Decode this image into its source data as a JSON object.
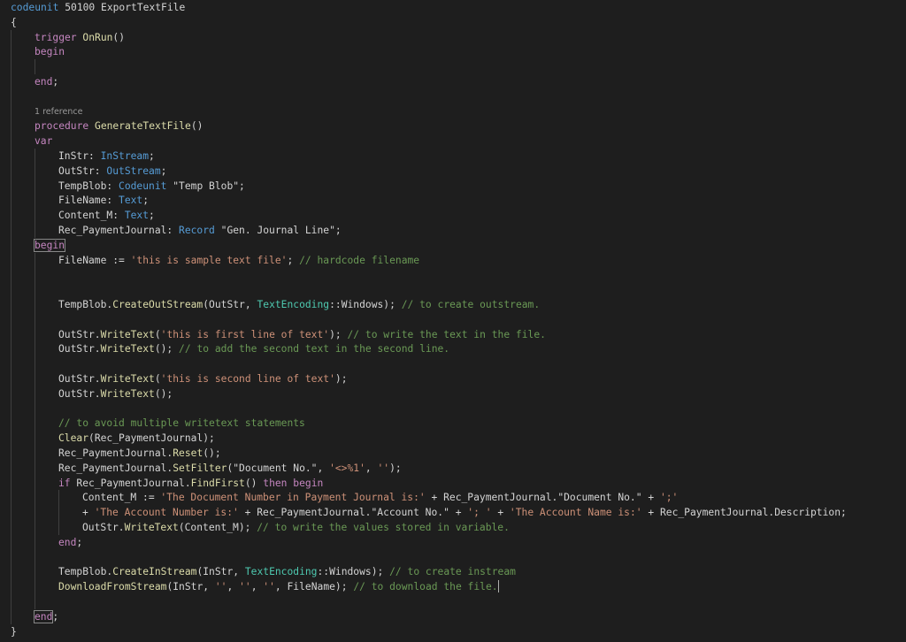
{
  "editor": {
    "theme_colors": {
      "background": "#1e1e1e",
      "keyword": "#569cd6",
      "type": "#4ec9b0",
      "string": "#ce9178",
      "comment": "#6a9955",
      "text": "#d4d4d4",
      "indent_guide": "#404040",
      "bracket_match": "#888888"
    },
    "lines": [
      {
        "indent": 0,
        "tokens": [
          {
            "t": "codeunit",
            "c": "#569cd6"
          },
          {
            "t": " 50100 ExportTextFile",
            "c": "#d4d4d4"
          }
        ]
      },
      {
        "indent": 0,
        "tokens": [
          {
            "t": "{",
            "c": "#d4d4d4"
          }
        ]
      },
      {
        "indent": 1,
        "tokens": [
          {
            "t": "trigger",
            "c": "#c586c0"
          },
          {
            "t": " OnRun",
            "c": "#dcdcaa"
          },
          {
            "t": "()",
            "c": "#d4d4d4"
          }
        ]
      },
      {
        "indent": 1,
        "tokens": [
          {
            "t": "begin",
            "c": "#c586c0"
          }
        ]
      },
      {
        "indent": 0,
        "tokens": []
      },
      {
        "indent": 1,
        "tokens": [
          {
            "t": "end",
            "c": "#c586c0"
          },
          {
            "t": ";",
            "c": "#d4d4d4"
          }
        ]
      },
      {
        "indent": 0,
        "tokens": []
      },
      {
        "indent": 1,
        "lens": true,
        "tokens": [
          {
            "t": "1 reference",
            "c": "#999999"
          }
        ]
      },
      {
        "indent": 1,
        "tokens": [
          {
            "t": "procedure",
            "c": "#c586c0"
          },
          {
            "t": " GenerateTextFile",
            "c": "#dcdcaa"
          },
          {
            "t": "()",
            "c": "#d4d4d4"
          }
        ]
      },
      {
        "indent": 1,
        "tokens": [
          {
            "t": "var",
            "c": "#c586c0"
          }
        ]
      },
      {
        "indent": 2,
        "tokens": [
          {
            "t": "InStr: ",
            "c": "#d4d4d4"
          },
          {
            "t": "InStream",
            "c": "#569cd6"
          },
          {
            "t": ";",
            "c": "#d4d4d4"
          }
        ]
      },
      {
        "indent": 2,
        "tokens": [
          {
            "t": "OutStr: ",
            "c": "#d4d4d4"
          },
          {
            "t": "OutStream",
            "c": "#569cd6"
          },
          {
            "t": ";",
            "c": "#d4d4d4"
          }
        ]
      },
      {
        "indent": 2,
        "tokens": [
          {
            "t": "TempBlob: ",
            "c": "#d4d4d4"
          },
          {
            "t": "Codeunit",
            "c": "#569cd6"
          },
          {
            "t": " \"Temp Blob\";",
            "c": "#d4d4d4"
          }
        ]
      },
      {
        "indent": 2,
        "tokens": [
          {
            "t": "FileName: ",
            "c": "#d4d4d4"
          },
          {
            "t": "Text",
            "c": "#569cd6"
          },
          {
            "t": ";",
            "c": "#d4d4d4"
          }
        ]
      },
      {
        "indent": 2,
        "tokens": [
          {
            "t": "Content_M: ",
            "c": "#d4d4d4"
          },
          {
            "t": "Text",
            "c": "#569cd6"
          },
          {
            "t": ";",
            "c": "#d4d4d4"
          }
        ]
      },
      {
        "indent": 2,
        "tokens": [
          {
            "t": "Rec_PaymentJournal: ",
            "c": "#d4d4d4"
          },
          {
            "t": "Record",
            "c": "#569cd6"
          },
          {
            "t": " \"Gen. Journal Line\";",
            "c": "#d4d4d4"
          }
        ]
      },
      {
        "indent": 1,
        "bracket": true,
        "tokens": [
          {
            "t": "begin",
            "c": "#c586c0"
          }
        ]
      },
      {
        "indent": 2,
        "tokens": [
          {
            "t": "FileName := ",
            "c": "#d4d4d4"
          },
          {
            "t": "'this is sample text file'",
            "c": "#ce9178"
          },
          {
            "t": "; ",
            "c": "#d4d4d4"
          },
          {
            "t": "// hardcode filename",
            "c": "#6a9955"
          }
        ]
      },
      {
        "indent": 0,
        "tokens": []
      },
      {
        "indent": 0,
        "tokens": []
      },
      {
        "indent": 2,
        "tokens": [
          {
            "t": "TempBlob.",
            "c": "#d4d4d4"
          },
          {
            "t": "CreateOutStream",
            "c": "#dcdcaa"
          },
          {
            "t": "(OutStr, ",
            "c": "#d4d4d4"
          },
          {
            "t": "TextEncoding",
            "c": "#4ec9b0"
          },
          {
            "t": "::Windows); ",
            "c": "#d4d4d4"
          },
          {
            "t": "// to create outstream.",
            "c": "#6a9955"
          }
        ]
      },
      {
        "indent": 0,
        "tokens": []
      },
      {
        "indent": 2,
        "tokens": [
          {
            "t": "OutStr.",
            "c": "#d4d4d4"
          },
          {
            "t": "WriteText",
            "c": "#dcdcaa"
          },
          {
            "t": "(",
            "c": "#d4d4d4"
          },
          {
            "t": "'this is first line of text'",
            "c": "#ce9178"
          },
          {
            "t": "); ",
            "c": "#d4d4d4"
          },
          {
            "t": "// to write the text in the file.",
            "c": "#6a9955"
          }
        ]
      },
      {
        "indent": 2,
        "tokens": [
          {
            "t": "OutStr.",
            "c": "#d4d4d4"
          },
          {
            "t": "WriteText",
            "c": "#dcdcaa"
          },
          {
            "t": "(); ",
            "c": "#d4d4d4"
          },
          {
            "t": "// to add the second text in the second line.",
            "c": "#6a9955"
          }
        ]
      },
      {
        "indent": 0,
        "tokens": []
      },
      {
        "indent": 2,
        "tokens": [
          {
            "t": "OutStr.",
            "c": "#d4d4d4"
          },
          {
            "t": "WriteText",
            "c": "#dcdcaa"
          },
          {
            "t": "(",
            "c": "#d4d4d4"
          },
          {
            "t": "'this is second line of text'",
            "c": "#ce9178"
          },
          {
            "t": ");",
            "c": "#d4d4d4"
          }
        ]
      },
      {
        "indent": 2,
        "tokens": [
          {
            "t": "OutStr.",
            "c": "#d4d4d4"
          },
          {
            "t": "WriteText",
            "c": "#dcdcaa"
          },
          {
            "t": "();",
            "c": "#d4d4d4"
          }
        ]
      },
      {
        "indent": 0,
        "tokens": []
      },
      {
        "indent": 2,
        "tokens": [
          {
            "t": "// to avoid multiple writetext statements",
            "c": "#6a9955"
          }
        ]
      },
      {
        "indent": 2,
        "tokens": [
          {
            "t": "Clear",
            "c": "#dcdcaa"
          },
          {
            "t": "(Rec_PaymentJournal);",
            "c": "#d4d4d4"
          }
        ]
      },
      {
        "indent": 2,
        "tokens": [
          {
            "t": "Rec_PaymentJournal.",
            "c": "#d4d4d4"
          },
          {
            "t": "Reset",
            "c": "#dcdcaa"
          },
          {
            "t": "();",
            "c": "#d4d4d4"
          }
        ]
      },
      {
        "indent": 2,
        "tokens": [
          {
            "t": "Rec_PaymentJournal.",
            "c": "#d4d4d4"
          },
          {
            "t": "SetFilter",
            "c": "#dcdcaa"
          },
          {
            "t": "(\"Document No.\", ",
            "c": "#d4d4d4"
          },
          {
            "t": "'<>%1'",
            "c": "#ce9178"
          },
          {
            "t": ", ",
            "c": "#d4d4d4"
          },
          {
            "t": "''",
            "c": "#ce9178"
          },
          {
            "t": ");",
            "c": "#d4d4d4"
          }
        ]
      },
      {
        "indent": 2,
        "tokens": [
          {
            "t": "if",
            "c": "#c586c0"
          },
          {
            "t": " Rec_PaymentJournal.",
            "c": "#d4d4d4"
          },
          {
            "t": "FindFirst",
            "c": "#dcdcaa"
          },
          {
            "t": "() ",
            "c": "#d4d4d4"
          },
          {
            "t": "then",
            "c": "#c586c0"
          },
          {
            "t": " ",
            "c": "#d4d4d4"
          },
          {
            "t": "begin",
            "c": "#c586c0"
          }
        ]
      },
      {
        "indent": 3,
        "tokens": [
          {
            "t": "Content_M := ",
            "c": "#d4d4d4"
          },
          {
            "t": "'The Document Number in Payment Journal is:'",
            "c": "#ce9178"
          },
          {
            "t": " + Rec_PaymentJournal.\"Document No.\" + ",
            "c": "#d4d4d4"
          },
          {
            "t": "';'",
            "c": "#ce9178"
          }
        ]
      },
      {
        "indent": 3,
        "tokens": [
          {
            "t": "+ ",
            "c": "#d4d4d4"
          },
          {
            "t": "'The Account Number is:'",
            "c": "#ce9178"
          },
          {
            "t": " + Rec_PaymentJournal.\"Account No.\" + ",
            "c": "#d4d4d4"
          },
          {
            "t": "'; '",
            "c": "#ce9178"
          },
          {
            "t": " + ",
            "c": "#d4d4d4"
          },
          {
            "t": "'The Account Name is:'",
            "c": "#ce9178"
          },
          {
            "t": " + Rec_PaymentJournal.Description;",
            "c": "#d4d4d4"
          }
        ]
      },
      {
        "indent": 3,
        "tokens": [
          {
            "t": "OutStr.",
            "c": "#d4d4d4"
          },
          {
            "t": "WriteText",
            "c": "#dcdcaa"
          },
          {
            "t": "(Content_M); ",
            "c": "#d4d4d4"
          },
          {
            "t": "// to write the values stored in variable.",
            "c": "#6a9955"
          }
        ]
      },
      {
        "indent": 2,
        "tokens": [
          {
            "t": "end",
            "c": "#c586c0"
          },
          {
            "t": ";",
            "c": "#d4d4d4"
          }
        ]
      },
      {
        "indent": 0,
        "tokens": []
      },
      {
        "indent": 2,
        "tokens": [
          {
            "t": "TempBlob.",
            "c": "#d4d4d4"
          },
          {
            "t": "CreateInStream",
            "c": "#dcdcaa"
          },
          {
            "t": "(InStr, ",
            "c": "#d4d4d4"
          },
          {
            "t": "TextEncoding",
            "c": "#4ec9b0"
          },
          {
            "t": "::Windows); ",
            "c": "#d4d4d4"
          },
          {
            "t": "// to create instream",
            "c": "#6a9955"
          }
        ]
      },
      {
        "indent": 2,
        "tokens": [
          {
            "t": "DownloadFromStream",
            "c": "#dcdcaa"
          },
          {
            "t": "(InStr, ",
            "c": "#d4d4d4"
          },
          {
            "t": "''",
            "c": "#ce9178"
          },
          {
            "t": ", ",
            "c": "#d4d4d4"
          },
          {
            "t": "''",
            "c": "#ce9178"
          },
          {
            "t": ", ",
            "c": "#d4d4d4"
          },
          {
            "t": "''",
            "c": "#ce9178"
          },
          {
            "t": ", FileName); ",
            "c": "#d4d4d4"
          },
          {
            "t": "// to download the file.",
            "c": "#6a9955"
          }
        ],
        "caret": true
      },
      {
        "indent": 0,
        "tokens": []
      },
      {
        "indent": 1,
        "bracket": true,
        "tokens": [
          {
            "t": "end",
            "c": "#c586c0"
          },
          {
            "t": ";",
            "c": "#d4d4d4"
          }
        ]
      },
      {
        "indent": 0,
        "tokens": [
          {
            "t": "}",
            "c": "#d4d4d4"
          }
        ]
      }
    ]
  }
}
